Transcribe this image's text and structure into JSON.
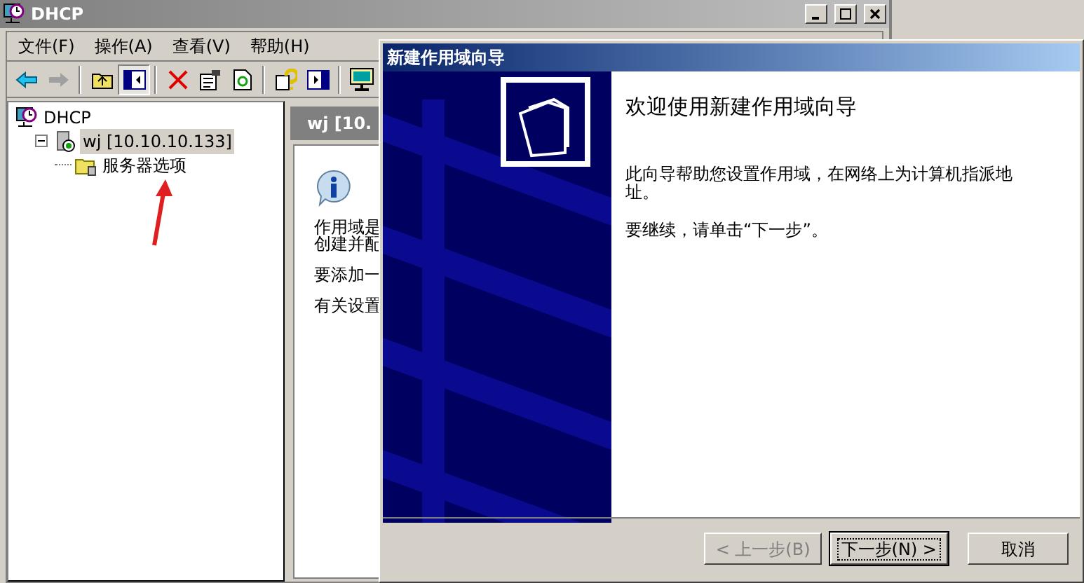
{
  "main_window": {
    "title": "DHCP",
    "menu": [
      {
        "label": "文件(F)"
      },
      {
        "label": "操作(A)"
      },
      {
        "label": "查看(V)"
      },
      {
        "label": "帮助(H)"
      }
    ],
    "tree": [
      {
        "label": "DHCP",
        "selected": false,
        "children": [
          {
            "label": "wj [10.10.10.133]",
            "selected": true,
            "expanded": true,
            "children": [
              {
                "label": "服务器选项",
                "selected": false
              }
            ]
          }
        ]
      }
    ],
    "detail_pane": {
      "header": "wj [10.",
      "paragraphs": [
        [
          "作用域是",
          "创建并配"
        ],
        [
          "要添加一"
        ],
        [
          "有关设置"
        ]
      ]
    }
  },
  "wizard": {
    "title": "新建作用域向导",
    "heading": "欢迎使用新建作用域向导",
    "paragraphs": [
      "此向导帮助您设置作用域，在网络上为计算机指派地址。",
      "要继续，请单击“下一步”。"
    ],
    "buttons": [
      {
        "label": "< 上一步(B)",
        "disabled": true,
        "focused": false
      },
      {
        "label": "下一步(N) >",
        "disabled": false,
        "focused": true
      },
      {
        "label": "取消",
        "disabled": false,
        "focused": false
      }
    ]
  }
}
